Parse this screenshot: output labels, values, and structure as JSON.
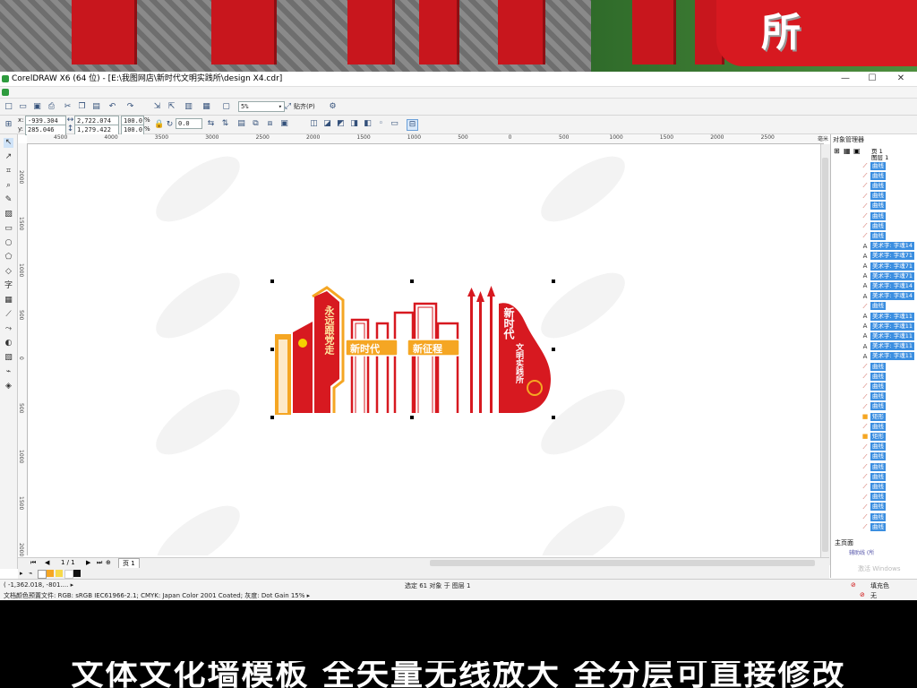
{
  "window": {
    "title": "CorelDRAW X6 (64 位) - [E:\\我图网店\\新时代文明实践所\\design X4.cdr]",
    "minimize": "—",
    "maximize": "☐",
    "close": "✕"
  },
  "toolbar": {
    "zoom_value": "5%",
    "snap_label": "贴齐(P)"
  },
  "property_bar": {
    "x": "-939.304 mm",
    "y": "285.046 mm",
    "width": "2,722.074 mm",
    "height": "1,279.422 mm",
    "scale_x": "100.0",
    "scale_y": "100.0",
    "percent": "%",
    "rotation": "0.0"
  },
  "ruler": {
    "h_ticks": [
      "4500",
      "4000",
      "3500",
      "3000",
      "2500",
      "2000",
      "1500",
      "1000",
      "500",
      "0",
      "500",
      "1000",
      "1500",
      "2000",
      "2500"
    ],
    "unit": "毫米",
    "v_ticks": [
      "2000",
      "1500",
      "1000",
      "500",
      "0",
      "500",
      "1000",
      "1500",
      "2000"
    ]
  },
  "page_nav": {
    "page_count": "1 / 1",
    "page_tab": "页 1"
  },
  "status": {
    "cursor": "( -1,362.018, -801.... ▸",
    "selection": "选定 61 对象 于 图层 1",
    "color_profile": "文档颜色预置文件: RGB: sRGB IEC61966-2.1; CMYK: Japan Color 2001 Coated; 灰度: Dot Gain 15% ▸",
    "fill_label": "填充色",
    "outline_label": "无"
  },
  "object_manager": {
    "title": "对象管理器",
    "page": "页 1",
    "layer": "图层 1",
    "master_page": "主页面",
    "guides_layer": "辅助线 (所",
    "activate_windows": "激活 Windows",
    "items": [
      {
        "type": "curve",
        "label": "曲线"
      },
      {
        "type": "curve",
        "label": "曲线"
      },
      {
        "type": "curve",
        "label": "曲线"
      },
      {
        "type": "curve",
        "label": "曲线"
      },
      {
        "type": "curve",
        "label": "曲线"
      },
      {
        "type": "curve",
        "label": "曲线"
      },
      {
        "type": "curve",
        "label": "曲线"
      },
      {
        "type": "curve",
        "label": "曲线"
      },
      {
        "type": "text",
        "label": "美术字: 字魂14"
      },
      {
        "type": "text",
        "label": "美术字: 字魂71"
      },
      {
        "type": "text",
        "label": "美术字: 字魂71"
      },
      {
        "type": "text",
        "label": "美术字: 字魂71"
      },
      {
        "type": "text",
        "label": "美术字: 字魂14"
      },
      {
        "type": "text",
        "label": "美术字: 字魂14"
      },
      {
        "type": "curve",
        "label": "曲线"
      },
      {
        "type": "text",
        "label": "美术字: 字魂11"
      },
      {
        "type": "text",
        "label": "美术字: 字魂11"
      },
      {
        "type": "text",
        "label": "美术字: 字魂11"
      },
      {
        "type": "text",
        "label": "美术字: 字魂11"
      },
      {
        "type": "text",
        "label": "美术字: 字魂11"
      },
      {
        "type": "curve",
        "label": "曲线"
      },
      {
        "type": "curve",
        "label": "曲线"
      },
      {
        "type": "curve",
        "label": "曲线"
      },
      {
        "type": "curve",
        "label": "曲线"
      },
      {
        "type": "curve",
        "label": "曲线"
      },
      {
        "type": "rect",
        "label": "矩形"
      },
      {
        "type": "curve",
        "label": "曲线"
      },
      {
        "type": "rect",
        "label": "矩形"
      },
      {
        "type": "curve",
        "label": "曲线"
      },
      {
        "type": "curve",
        "label": "曲线"
      },
      {
        "type": "curve",
        "label": "曲线"
      },
      {
        "type": "curve",
        "label": "曲线"
      },
      {
        "type": "curve",
        "label": "曲线"
      },
      {
        "type": "curve",
        "label": "曲线"
      },
      {
        "type": "curve",
        "label": "曲线"
      },
      {
        "type": "curve",
        "label": "曲线"
      },
      {
        "type": "curve",
        "label": "曲线"
      }
    ]
  },
  "artwork": {
    "left_vertical_text": "永远跟党走",
    "sign1": "新时代",
    "sign2": "新征程",
    "right_title": "新时代",
    "right_sub": "文明实践所",
    "colors": {
      "red": "#d71920",
      "orange": "#f5a623",
      "deep_red": "#b5121b"
    }
  },
  "photo": {
    "sign_text": "所"
  },
  "banner": {
    "text": "文体文化墙模板 全矢量无线放大 全分层可直接修改"
  }
}
